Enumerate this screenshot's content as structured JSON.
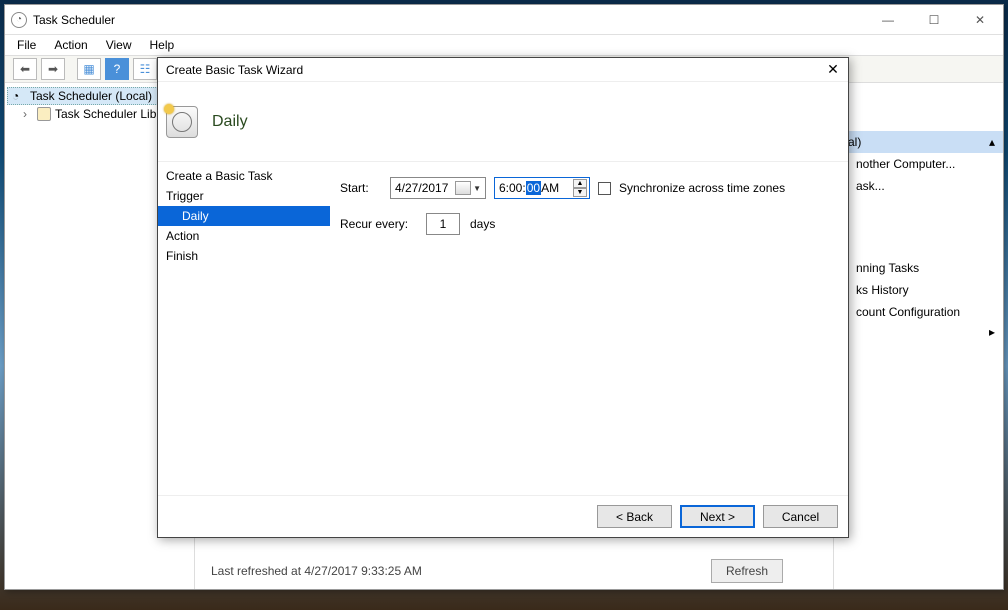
{
  "window": {
    "title": "Task Scheduler",
    "menus": [
      "File",
      "Action",
      "View",
      "Help"
    ],
    "tree": {
      "root": "Task Scheduler (Local)",
      "lib": "Task Scheduler Libr"
    },
    "status": "Last refreshed at 4/27/2017 9:33:25 AM",
    "refresh_btn": "Refresh"
  },
  "actions": {
    "header": "cal)",
    "items": [
      "nother Computer...",
      "ask..."
    ],
    "running": "nning Tasks",
    "history": "ks History",
    "account": "count Configuration"
  },
  "wizard": {
    "title": "Create Basic Task Wizard",
    "heading": "Daily",
    "nav": {
      "create": "Create a Basic Task",
      "trigger": "Trigger",
      "daily": "Daily",
      "action": "Action",
      "finish": "Finish"
    },
    "start_label": "Start:",
    "date": "4/27/2017",
    "time_h": "6:00:",
    "time_sel": "00",
    "time_ampm": " AM",
    "sync": "Synchronize across time zones",
    "recur_label": "Recur every:",
    "recur_value": "1",
    "recur_unit": "days",
    "back": "< Back",
    "next": "Next >",
    "cancel": "Cancel"
  }
}
